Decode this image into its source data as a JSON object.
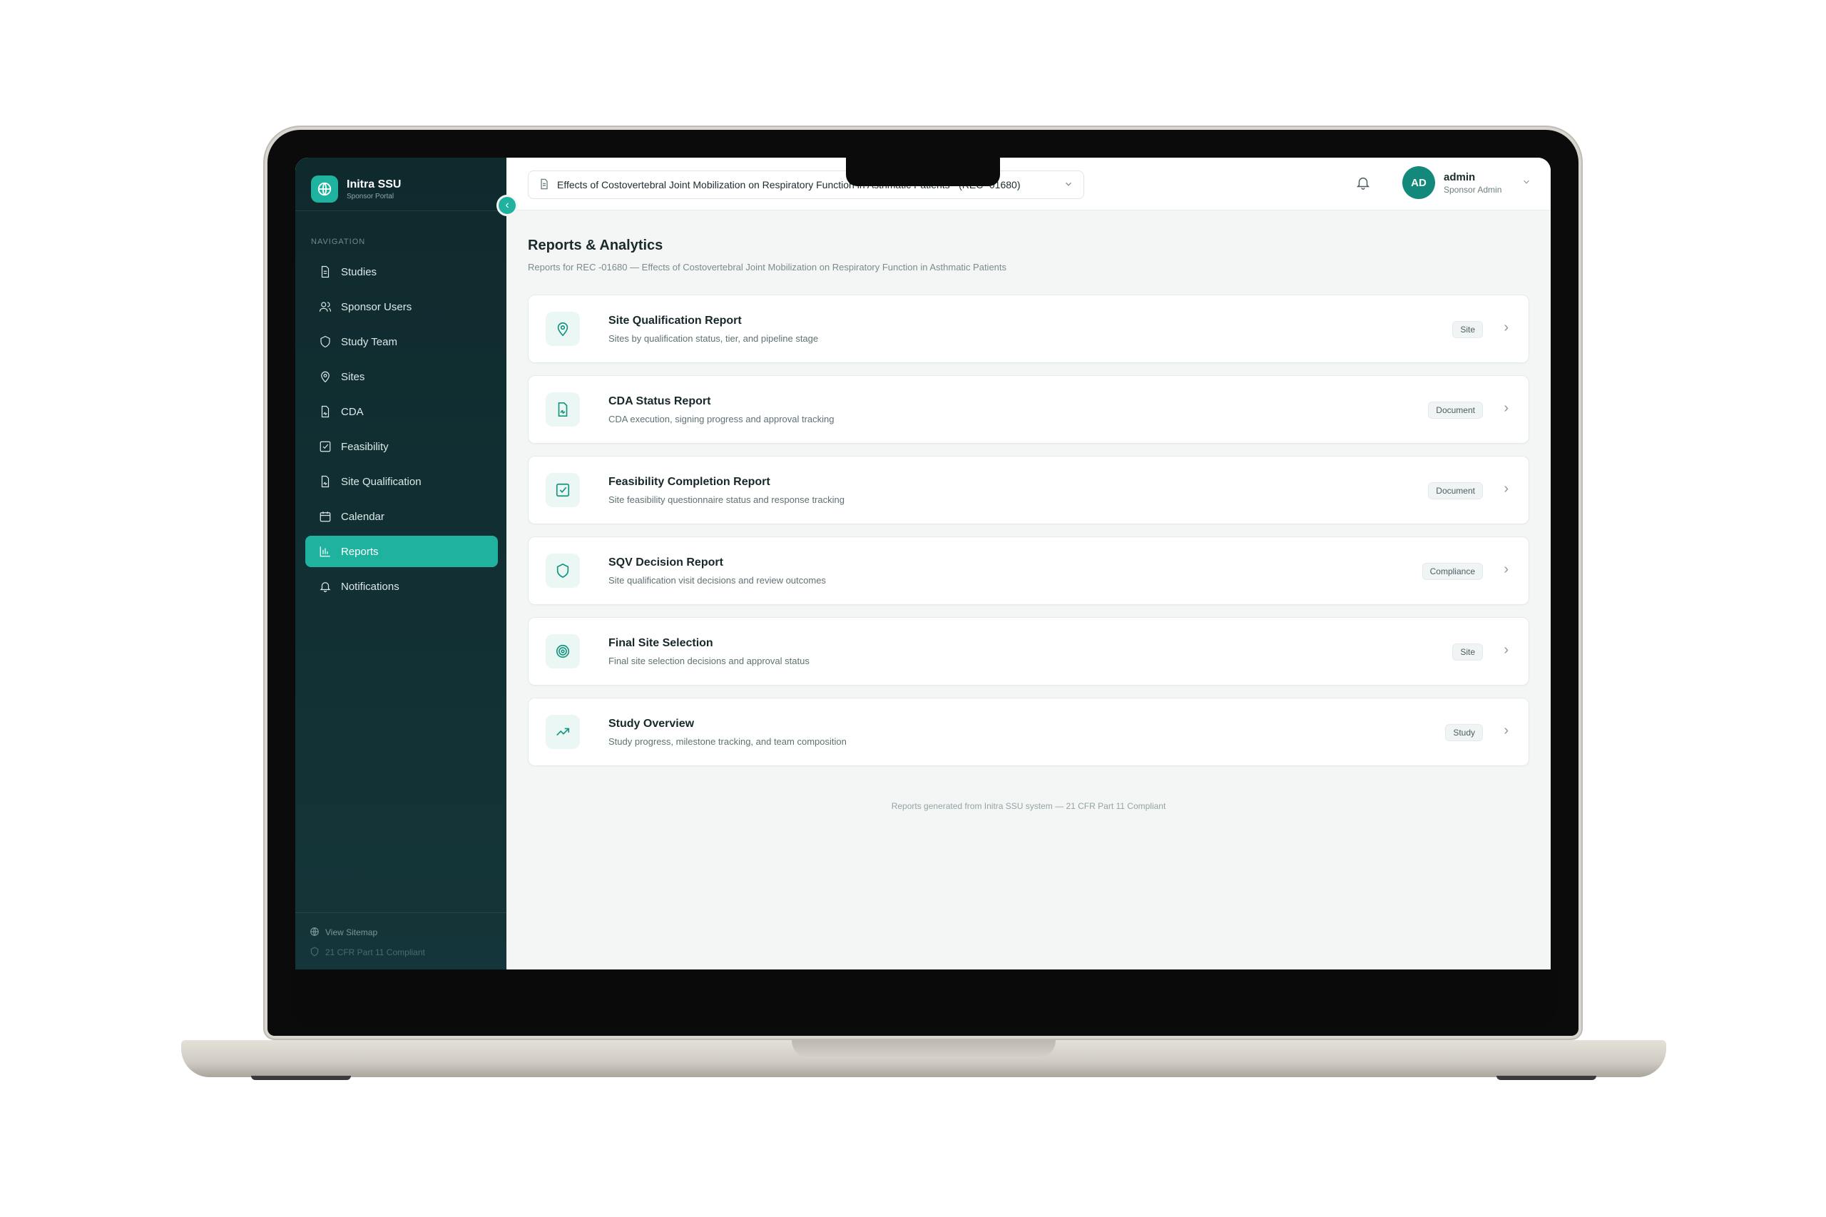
{
  "brand": {
    "name": "Initra SSU",
    "subtitle": "Sponsor Portal"
  },
  "sidebar": {
    "heading": "NAVIGATION",
    "items": [
      {
        "label": "Studies",
        "icon": "document-icon",
        "active": false
      },
      {
        "label": "Sponsor Users",
        "icon": "users-icon",
        "active": false
      },
      {
        "label": "Study Team",
        "icon": "shield-icon",
        "active": false
      },
      {
        "label": "Sites",
        "icon": "map-pin-icon",
        "active": false
      },
      {
        "label": "CDA",
        "icon": "file-signature-icon",
        "active": false
      },
      {
        "label": "Feasibility",
        "icon": "check-square-icon",
        "active": false
      },
      {
        "label": "Site Qualification",
        "icon": "file-signature-icon",
        "active": false
      },
      {
        "label": "Calendar",
        "icon": "calendar-icon",
        "active": false
      },
      {
        "label": "Reports",
        "icon": "bar-chart-icon",
        "active": true
      },
      {
        "label": "Notifications",
        "icon": "bell-icon",
        "active": false
      }
    ],
    "footer": {
      "sitemap": "View Sitemap",
      "compliance": "21 CFR Part 11 Compliant"
    }
  },
  "topbar": {
    "study_select": "Effects of Costovertebral Joint Mobilization on Respiratory Function in Asthmatic Patients - (REC -01680)",
    "user": {
      "initials": "AD",
      "name": "admin",
      "role": "Sponsor Admin"
    }
  },
  "main": {
    "title": "Reports & Analytics",
    "subtitle": "Reports for REC -01680 — Effects of Costovertebral Joint Mobilization on Respiratory Function in Asthmatic Patients",
    "reports": [
      {
        "title": "Site Qualification Report",
        "description": "Sites by qualification status, tier, and pipeline stage",
        "tag": "Site",
        "icon": "map-pin-icon"
      },
      {
        "title": "CDA Status Report",
        "description": "CDA execution, signing progress and approval tracking",
        "tag": "Document",
        "icon": "file-signature-icon"
      },
      {
        "title": "Feasibility Completion Report",
        "description": "Site feasibility questionnaire status and response tracking",
        "tag": "Document",
        "icon": "check-square-icon"
      },
      {
        "title": "SQV Decision Report",
        "description": "Site qualification visit decisions and review outcomes",
        "tag": "Compliance",
        "icon": "shield-icon"
      },
      {
        "title": "Final Site Selection",
        "description": "Final site selection decisions and approval status",
        "tag": "Site",
        "icon": "target-icon"
      },
      {
        "title": "Study Overview",
        "description": "Study progress, milestone tracking, and team composition",
        "tag": "Study",
        "icon": "trending-up-icon"
      }
    ],
    "footer_note": "Reports generated from Initra SSU system — 21 CFR Part 11 Compliant"
  },
  "colors": {
    "accent": "#1fb39f",
    "sidebar_bg": "#0f2a2d",
    "avatar": "#12897b"
  }
}
